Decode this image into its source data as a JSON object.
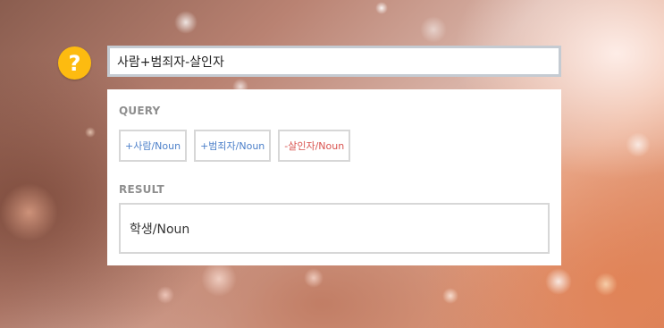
{
  "search": {
    "value": "사람+범죄자-살인자"
  },
  "help": {
    "icon": "question-icon",
    "glyph": "?",
    "color": "#fdbb10"
  },
  "query": {
    "label": "QUERY",
    "chips": [
      {
        "text": "+사람/Noun",
        "sign": "positive",
        "color": "#4b7fc9"
      },
      {
        "text": "+범죄자/Noun",
        "sign": "positive",
        "color": "#4b7fc9"
      },
      {
        "text": "-살인자/Noun",
        "sign": "negative",
        "color": "#d9534f"
      }
    ]
  },
  "result": {
    "label": "RESULT",
    "value": "학생/Noun"
  }
}
